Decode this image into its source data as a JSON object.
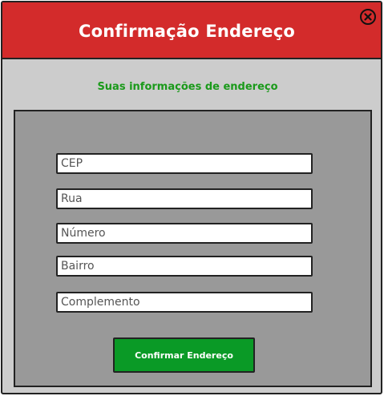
{
  "dialog": {
    "title": "Confirmação Endereço",
    "close_icon": "close-circle-icon",
    "subtitle": "Suas informações de endereço"
  },
  "form": {
    "fields": [
      {
        "placeholder": "CEP",
        "value": ""
      },
      {
        "placeholder": "Rua",
        "value": ""
      },
      {
        "placeholder": "Número",
        "value": ""
      },
      {
        "placeholder": "Bairro",
        "value": ""
      },
      {
        "placeholder": "Complemento",
        "value": ""
      }
    ],
    "confirm_label": "Confirmar Endereço"
  },
  "colors": {
    "titlebar": "#d32b2b",
    "dialog_bg": "#cccccc",
    "panel_bg": "#999999",
    "subtitle": "#1a9a1a",
    "confirm_button": "#0a9a26"
  }
}
